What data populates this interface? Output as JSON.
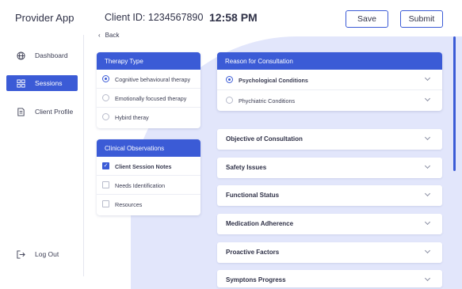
{
  "header": {
    "app_title": "Provider App",
    "client_id": "Client ID: 1234567890",
    "time": "12:58 PM",
    "save_label": "Save",
    "submit_label": "Submit"
  },
  "sidebar": {
    "items": [
      {
        "label": "Dashboard",
        "icon": "globe-icon"
      },
      {
        "label": "Sessions",
        "icon": "grid-icon",
        "active": true
      },
      {
        "label": "Client Profile",
        "icon": "document-icon"
      }
    ],
    "logout_label": "Log Out"
  },
  "back_label": "Back",
  "therapy_type": {
    "title": "Therapy Type",
    "options": [
      "Cognitive behavioural therapy",
      "Emotionally focused therapy",
      "Hybird theray"
    ],
    "selected": "Cognitive behavioural therapy"
  },
  "clinical_observations": {
    "title": "Clinical Observations",
    "options": [
      "Client Session Notes",
      "Needs Identification",
      "Resources"
    ],
    "checked": [
      "Client Session Notes"
    ]
  },
  "reason": {
    "title": "Reason for Consultation",
    "options": [
      "Psychological Conditions",
      "Phychiatric Conditions"
    ],
    "selected": "Psychological Conditions"
  },
  "accordions": [
    "Objective of Consultation",
    "Safety Issues",
    "Functional Status",
    "Medication Adherence",
    "Proactive Factors",
    "Symptons Progress"
  ],
  "colors": {
    "accent": "#3b5bd6",
    "blob": "#e2e6fb"
  }
}
